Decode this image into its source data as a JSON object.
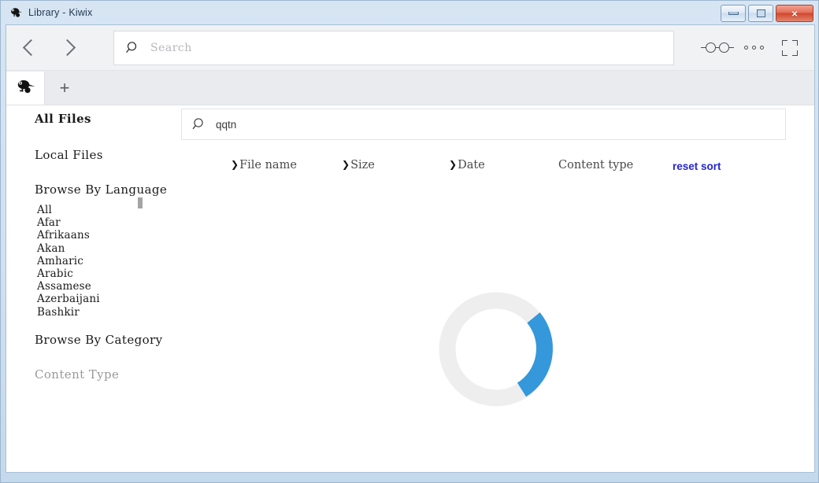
{
  "window": {
    "title": "Library - Kiwix",
    "app_icon": "kiwi-bird-icon",
    "controls": {
      "minimize": "minimize-button",
      "maximize": "maximize-button",
      "close": "×"
    }
  },
  "toolbar": {
    "back_icon": "chevron-left-icon",
    "forward_icon": "chevron-right-icon",
    "search": {
      "icon": "search-icon",
      "placeholder": "Search",
      "value": ""
    },
    "reader_icon": "reading-glasses-icon",
    "menu_icon": "three-dots-icon",
    "fullscreen_icon": "fullscreen-icon"
  },
  "tabs": {
    "active_icon": "kiwi-bird-icon",
    "new_tab_label": "+"
  },
  "sidebar": {
    "all_files": "All Files",
    "local_files": "Local Files",
    "browse_by_language": "Browse By Language",
    "languages": [
      "All",
      "Afar",
      "Afrikaans",
      "Akan",
      "Amharic",
      "Arabic",
      "Assamese",
      "Azerbaijani",
      "Bashkir"
    ],
    "browse_by_category": "Browse By Category",
    "content_type": "Content Type"
  },
  "library": {
    "search": {
      "icon": "search-icon",
      "value": "qqtn",
      "placeholder": "Search"
    },
    "sort": {
      "arrow": "❯",
      "file_name": "File name",
      "size": "Size",
      "date": "Date",
      "content_type": "Content type",
      "reset": "reset sort"
    },
    "loading": {
      "icon": "loading-spinner-icon",
      "track_color": "#eeeeee",
      "arc_color": "#3498db"
    }
  },
  "colors": {
    "accent_blue": "#3498db",
    "link_blue": "#2424cf",
    "frame_blue": "#cfe0f0",
    "close_red": "#d1462c"
  }
}
